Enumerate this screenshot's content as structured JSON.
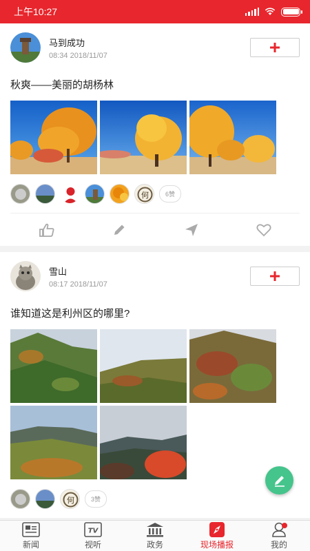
{
  "status_bar": {
    "time": "上午10:27"
  },
  "posts": [
    {
      "author": "马到成功",
      "time": "08:34 2018/11/07",
      "text": "秋爽——美丽的胡杨林",
      "like_count": "6赞"
    },
    {
      "author": "雪山",
      "time": "08:17 2018/11/07",
      "text": "谁知道这是利州区的哪里?",
      "like_count": "3赞"
    }
  ],
  "tabs": [
    {
      "label": "新闻",
      "icon": "news-icon"
    },
    {
      "label": "视听",
      "icon": "tv-icon"
    },
    {
      "label": "政务",
      "icon": "government-icon"
    },
    {
      "label": "现场播报",
      "icon": "compass-icon"
    },
    {
      "label": "我的",
      "icon": "profile-icon"
    }
  ],
  "active_tab": "现场播报",
  "colors": {
    "brand_red": "#e8262d",
    "fab_green": "#45c48c"
  }
}
